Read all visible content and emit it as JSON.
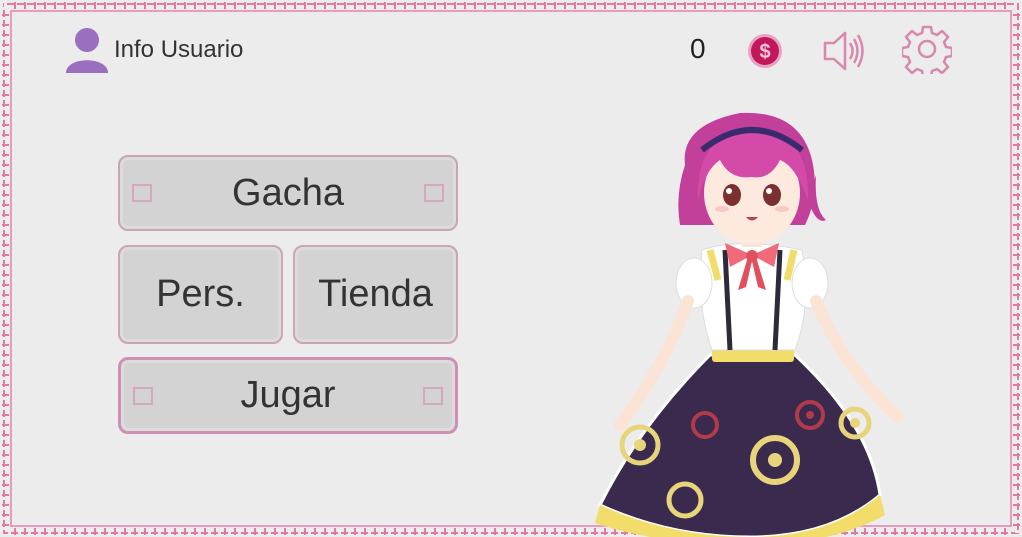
{
  "header": {
    "user_label": "Info Usuario",
    "coin_count": "0",
    "icons": [
      "user-icon",
      "coin-icon",
      "sound-icon",
      "gear-icon"
    ]
  },
  "menu": {
    "gacha": "Gacha",
    "pers": "Pers.",
    "tienda": "Tienda",
    "jugar": "Jugar"
  },
  "colors": {
    "background": "#ececec",
    "border_pink": "#e07aa5",
    "button_fill": "#d3d3d3",
    "button_border": "#c9a5b7",
    "user_icon": "#9b6fbf",
    "coin": "#c2185b",
    "icon_pink": "#d987ac"
  }
}
